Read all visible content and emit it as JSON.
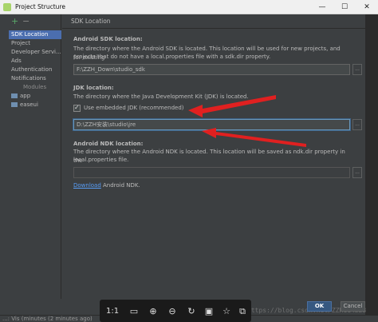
{
  "window": {
    "title": "Project Structure",
    "minimize": "—",
    "maximize": "☐",
    "close": "✕"
  },
  "toolbar": {
    "add": "+",
    "remove": "−"
  },
  "sidebar": {
    "items": [
      {
        "label": "SDK Location"
      },
      {
        "label": "Project"
      },
      {
        "label": "Developer Servi..."
      },
      {
        "label": "Ads"
      },
      {
        "label": "Authentication"
      },
      {
        "label": "Notifications"
      }
    ],
    "modules_header": "Modules",
    "modules": [
      {
        "label": "app"
      },
      {
        "label": "easeui"
      }
    ]
  },
  "main": {
    "title": "SDK Location",
    "android_sdk": {
      "heading": "Android SDK location:",
      "desc1": "The directory where the Android SDK is located. This location will be used for new projects, and for existing",
      "desc2": "projects that do not have a local.properties file with a sdk.dir property.",
      "value": "F:\\ZZH_Down\\studio_sdk",
      "browse": "..."
    },
    "jdk": {
      "heading": "JDK location:",
      "desc": "The directory where the Java Development Kit (JDK) is located.",
      "checkbox_label": "Use embedded JDK (recommended)",
      "checkbox_checked": true,
      "value": "D:\\ZZH安装\\studio\\jre",
      "browse": "..."
    },
    "ndk": {
      "heading": "Android NDK location:",
      "desc1": "The directory where the Android NDK is located. This location will be saved as ndk.dir property in the",
      "desc2": "local.properties file.",
      "value": "",
      "browse": "...",
      "download_link": "Download",
      "download_rest": "Android NDK."
    }
  },
  "buttons": {
    "ok": "OK",
    "cancel": "Cancel"
  },
  "status": {
    "text": "...: Vis (minutes (2 minutes ago)"
  },
  "watermark": "https://blog.csdn.net/ZZH114323",
  "viewer": {
    "ratio": "1:1",
    "icons": [
      "fit-screen-icon",
      "zoom-in-icon",
      "zoom-out-icon",
      "rotate-icon",
      "save-icon",
      "bookmark-icon",
      "copy-icon",
      "share-icon",
      "more-icon"
    ]
  },
  "colors": {
    "accent": "#4b6eaf",
    "arrow": "#e02020",
    "link": "#589df6"
  }
}
